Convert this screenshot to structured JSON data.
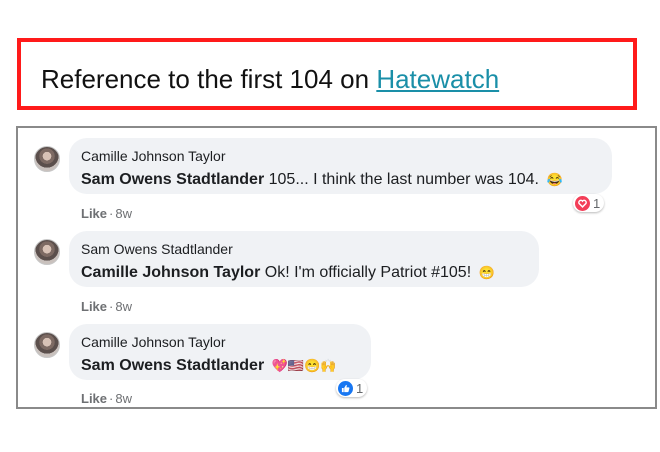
{
  "banner": {
    "text": "Reference to the first 104 on ",
    "link": "Hatewatch"
  },
  "comments": [
    {
      "author": "Camille Johnson Taylor",
      "mention": "Sam Owens Stadtlander",
      "text": " 105... I think the last number was 104. ",
      "emoji": "😂",
      "like_label": "Like",
      "time": "8w",
      "reaction": {
        "icon": "heart-reaction-icon",
        "count": "1",
        "color": "#f33e58"
      }
    },
    {
      "author": "Sam Owens Stadtlander",
      "mention": "Camille Johnson Taylor",
      "text": " Ok! I'm officially Patriot #105! ",
      "emoji": "😁",
      "like_label": "Like",
      "time": "8w"
    },
    {
      "author": "Camille Johnson Taylor",
      "mention": "Sam Owens Stadtlander",
      "text": " ",
      "emoji": "💖🇺🇸😁🙌",
      "like_label": "Like",
      "time": "8w",
      "reaction": {
        "icon": "thumbs-up-reaction-icon",
        "count": "1",
        "color": "#1877f2"
      }
    }
  ]
}
